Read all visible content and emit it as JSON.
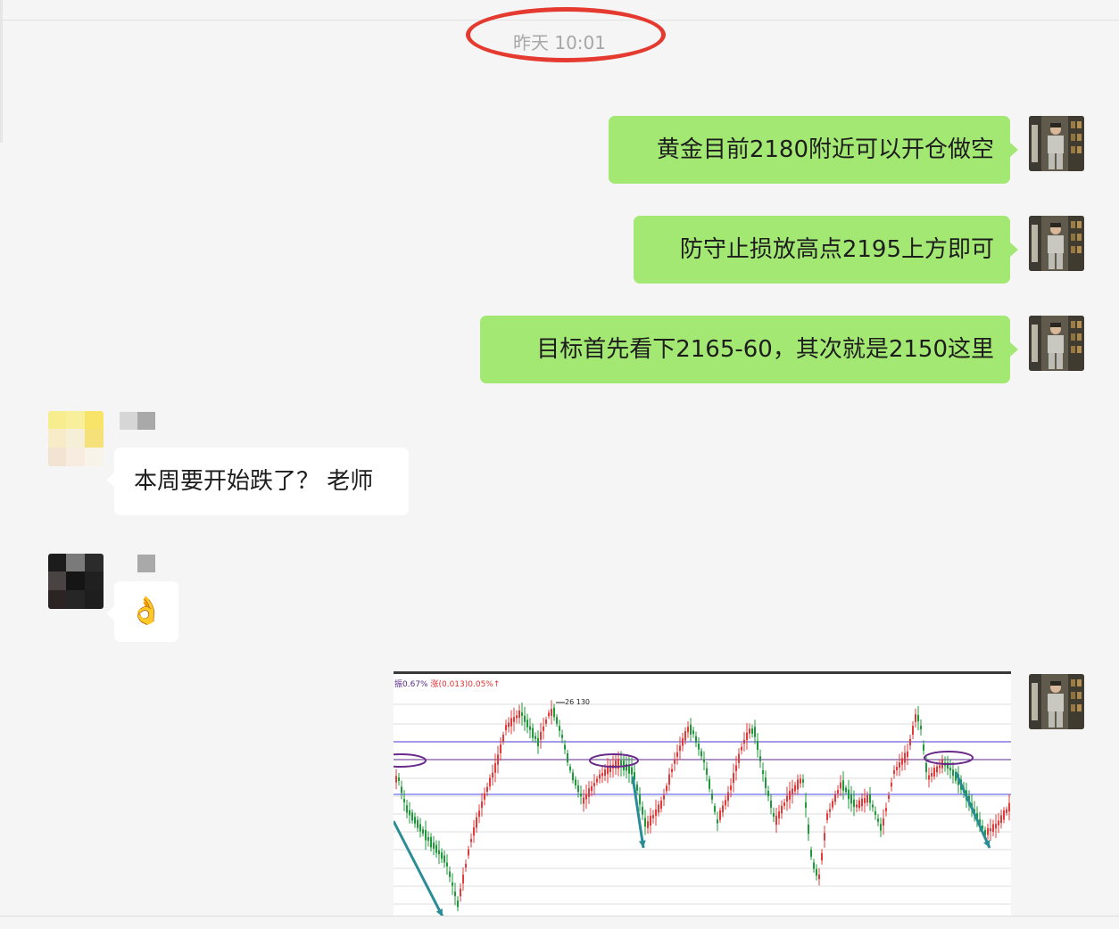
{
  "header": {
    "time": "昨天 10:01"
  },
  "messages": [
    {
      "side": "me",
      "text": "黄金目前2180附近可以开仓做空"
    },
    {
      "side": "me",
      "text": "防守止损放高点2195上方即可"
    },
    {
      "side": "me",
      "text": "目标首先看下2165-60，其次就是2150这里"
    },
    {
      "side": "other",
      "text": "本周要开始跌了？ 老师"
    },
    {
      "side": "other",
      "text": "👌"
    }
  ],
  "chart": {
    "header_left": "振0.67%",
    "header_right": "涨(0.013)0.05%↑",
    "peak_label": "26 130"
  },
  "colors": {
    "bubble_me": "#a4e874",
    "bubble_other": "#ffffff",
    "highlight_circle": "#e53a2f",
    "candle_up": "#e23b3b",
    "candle_down": "#1f9a3a",
    "trend_arrow": "#2a8c94"
  }
}
